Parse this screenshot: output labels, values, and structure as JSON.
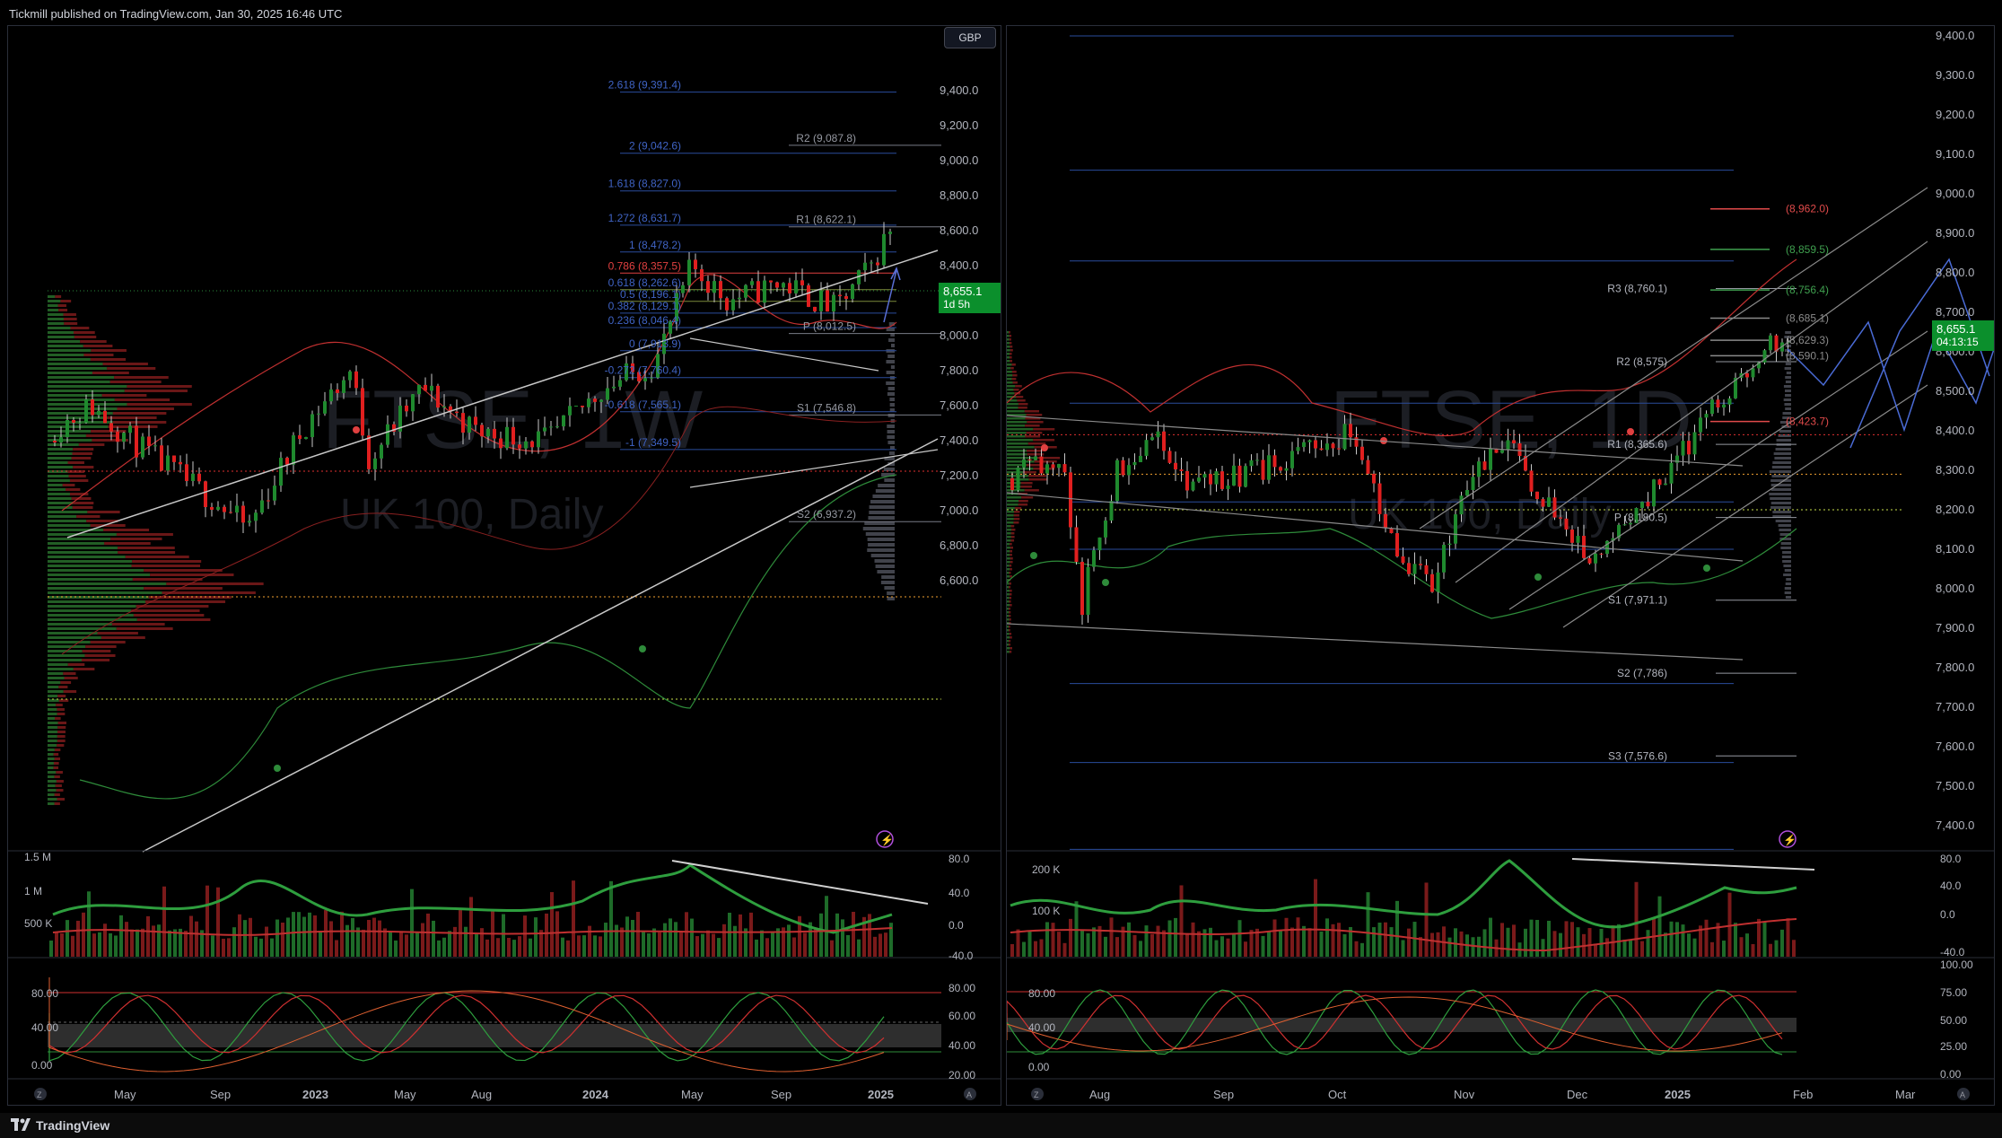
{
  "header": {
    "published_text": "Tickmill published on TradingView.com, Jan 30, 2025 16:46 UTC"
  },
  "footer": {
    "brand": "TradingView"
  },
  "colors": {
    "up": "#1f8a2e",
    "down": "#e01f1f",
    "fib": "#2a4c9c",
    "pivot": "#9598a1",
    "background": "#000000",
    "price_label": "#0b8f2c"
  },
  "left_chart": {
    "currency": "GBP",
    "watermark_symbol": "FTSE, 1W",
    "watermark_name": "UK 100, Daily",
    "price": {
      "value": "8,655.1",
      "countdown": "1d 5h"
    },
    "price_axis": [
      "9,400.0",
      "9,200.0",
      "9,000.0",
      "8,800.0",
      "8,600.0",
      "8,400.0",
      "8,200.0",
      "8,000.0",
      "7,800.0",
      "7,600.0",
      "7,400.0",
      "7,200.0",
      "7,000.0",
      "6,800.0",
      "6,600.0"
    ],
    "fib_levels": [
      "2.618 (9,391.4)",
      "2 (9,042.6)",
      "1.618 (8,827.0)",
      "1.272 (8,631.7)",
      "1 (8,478.2)",
      "0.786 (8,357.5)",
      "0.618 (8,262.6)",
      "0.5 (8,196.1)",
      "0.382 (8,129.1)",
      "0.236 (8,046.4)",
      "0 (7,913.9)",
      "-0.272 (7,760.4)",
      "-0.618 (7,565.1)",
      "-1 (7,349.5)"
    ],
    "pivots": [
      "R2 (9,087.8)",
      "R1 (8,622.1)",
      "P (8,012.5)",
      "S1 (7,546.8)",
      "S2 (6,937.2)"
    ],
    "volume_axis": [
      "1.5 M",
      "1 M",
      "500 K"
    ],
    "osc_axis": [
      "80.0",
      "40.0",
      "0.0",
      "-40.0"
    ],
    "stoch_left_axis": [
      "80.00",
      "40.00",
      "0.00"
    ],
    "stoch_right_axis": [
      "80.00",
      "60.00",
      "40.00",
      "20.00"
    ],
    "time_axis": [
      "May",
      "Sep",
      "2023",
      "May",
      "Aug",
      "2024",
      "May",
      "Sep",
      "2025"
    ]
  },
  "right_chart": {
    "watermark_symbol": "FTSE, 1D",
    "watermark_name": "UK 100, Daily",
    "price": {
      "value": "8,655.1",
      "countdown": "04:13:15"
    },
    "price_axis": [
      "9,400.0",
      "9,300.0",
      "9,200.0",
      "9,100.0",
      "9,000.0",
      "8,900.0",
      "8,800.0",
      "8,700.0",
      "8,600.0",
      "8,500.0",
      "8,400.0",
      "8,300.0",
      "8,200.0",
      "8,100.0",
      "8,000.0",
      "7,900.0",
      "7,800.0",
      "7,700.0",
      "7,600.0",
      "7,500.0",
      "7,400.0"
    ],
    "pivots": [
      "R3 (8,760.1)",
      "R2 (8,575)",
      "R1 (8,365.6)",
      "P (8,180.5)",
      "S1 (7,971.1)",
      "S2 (7,786)",
      "S3 (7,576.6)"
    ],
    "fib_levels": [
      "(8,962.0)",
      "(8,859.5)",
      "(8,756.4)",
      "(8,685.1)",
      "(8,629.3)",
      "(8,590.1)",
      "(8,423.7)"
    ],
    "volume_axis": [
      "200 K",
      "100 K"
    ],
    "osc_axis": [
      "80.0",
      "40.0",
      "0.0",
      "-40.0"
    ],
    "stoch_left_axis": [
      "80.00",
      "40.00",
      "0.00"
    ],
    "stoch_right_axis": [
      "100.00",
      "75.00",
      "50.00",
      "25.00",
      "0.00"
    ],
    "time_axis": [
      "Aug",
      "Sep",
      "Oct",
      "Nov",
      "Dec",
      "2025",
      "Feb",
      "Mar"
    ]
  },
  "chart_data": [
    {
      "type": "candlestick",
      "title": "FTSE, 1W — UK 100",
      "ylim": [
        6560,
        9500
      ],
      "x": [
        "May 2022",
        "Sep 2022",
        "2023",
        "May 2023",
        "Aug 2023",
        "2024",
        "May 2024",
        "Sep 2024",
        "2025"
      ],
      "close": [
        7500,
        7150,
        7700,
        7650,
        7450,
        7600,
        8250,
        8300,
        8655
      ]
    },
    {
      "type": "candlestick",
      "title": "FTSE, 1D — UK 100",
      "ylim": [
        7330,
        9450
      ],
      "x": [
        "Aug",
        "Sep",
        "Oct",
        "Nov",
        "Dec",
        "2025",
        "Feb"
      ],
      "close": [
        8300,
        8350,
        8280,
        8100,
        8320,
        8200,
        8655
      ]
    }
  ]
}
